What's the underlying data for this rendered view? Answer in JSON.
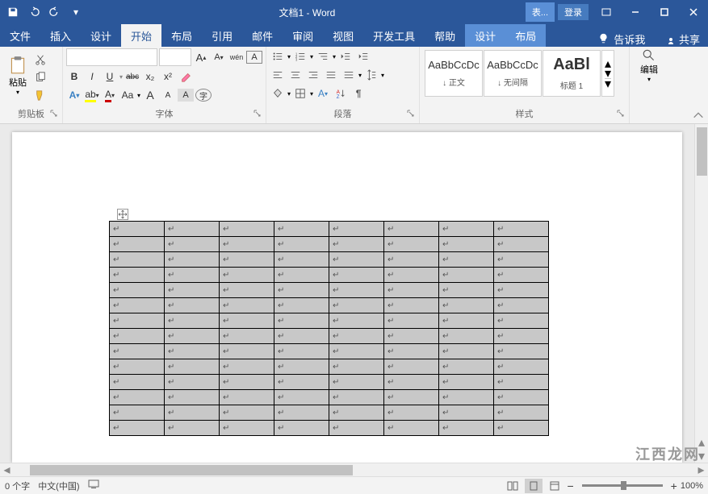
{
  "window": {
    "title": "文档1 - Word",
    "context_tab": "表...",
    "login": "登录"
  },
  "tabs": {
    "file": "文件",
    "insert": "插入",
    "design": "设计",
    "home": "开始",
    "layout": "布局",
    "references": "引用",
    "mailings": "邮件",
    "review": "审阅",
    "view": "视图",
    "devtools": "开发工具",
    "help": "帮助",
    "ctx_design": "设计",
    "ctx_layout": "布局",
    "tellme": "告诉我",
    "share": "共享"
  },
  "ribbon": {
    "paste": "粘贴",
    "clipboard_label": "剪贴板",
    "font_label": "字体",
    "paragraph_label": "段落",
    "styles_label": "样式",
    "edit_label": "编辑",
    "font_name": "",
    "font_size": "",
    "bold": "B",
    "italic": "I",
    "underline": "U",
    "strike": "abc",
    "sub": "x₂",
    "sup": "x²",
    "Aa": "Aa",
    "bigA": "A",
    "smallA": "A",
    "Astyle": "A",
    "wen": "wén",
    "styles": [
      {
        "preview": "AaBbCcDc",
        "name": "↓ 正文"
      },
      {
        "preview": "AaBbCcDc",
        "name": "↓ 无间隔"
      },
      {
        "preview": "AaBl",
        "name": "标题 1"
      }
    ]
  },
  "table": {
    "rows": 14,
    "cols": 8,
    "cellmark": "↵"
  },
  "statusbar": {
    "words": "0 个字",
    "lang": "中文(中国)",
    "zoom": "100%"
  },
  "watermark": "江西龙网"
}
